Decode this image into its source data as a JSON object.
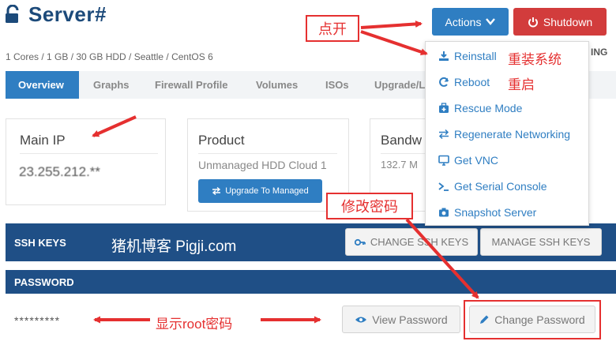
{
  "header": {
    "title": "Server#",
    "specs": "1 Cores / 1 GB / 30 GB HDD / Seattle / CentOS 6",
    "status_fragment": "ING",
    "actions_label": "Actions",
    "shutdown_label": "Shutdown"
  },
  "tabs": [
    "Overview",
    "Graphs",
    "Firewall Profile",
    "Volumes",
    "ISOs",
    "Upgrade/Li"
  ],
  "cards": {
    "main_ip": {
      "title": "Main IP",
      "value": "23.255.212.**"
    },
    "product": {
      "title": "Product",
      "value": "Unmanaged HDD Cloud 1",
      "upgrade_label": "Upgrade To Managed"
    },
    "bandwidth": {
      "title": "Bandw",
      "value": "132.7 M"
    }
  },
  "ssh": {
    "label": "SSH KEYS",
    "change_label": "CHANGE SSH KEYS",
    "manage_label": "MANAGE SSH KEYS"
  },
  "password": {
    "label": "PASSWORD",
    "masked": "*********",
    "view_label": "View Password",
    "change_label": "Change Password"
  },
  "actions_menu": [
    {
      "label": "Reinstall",
      "icon": "download-icon"
    },
    {
      "label": "Reboot",
      "icon": "refresh-icon"
    },
    {
      "label": "Rescue Mode",
      "icon": "medkit-icon"
    },
    {
      "label": "Regenerate Networking",
      "icon": "exchange-icon"
    },
    {
      "label": "Get VNC",
      "icon": "monitor-icon"
    },
    {
      "label": "Get Serial Console",
      "icon": "terminal-icon"
    },
    {
      "label": "Snapshot Server",
      "icon": "camera-icon"
    }
  ],
  "annotations": {
    "open": "点开",
    "reinstall": "重装系统",
    "reboot": "重启",
    "change_password": "修改密码",
    "watermark": "猪机博客 Pigji.com",
    "show_root_password": "显示root密码"
  },
  "colors": {
    "primary": "#2f7ec2",
    "danger": "#d23c3c",
    "navy_bar": "#1f4f86",
    "annotation_red": "#e53030"
  }
}
